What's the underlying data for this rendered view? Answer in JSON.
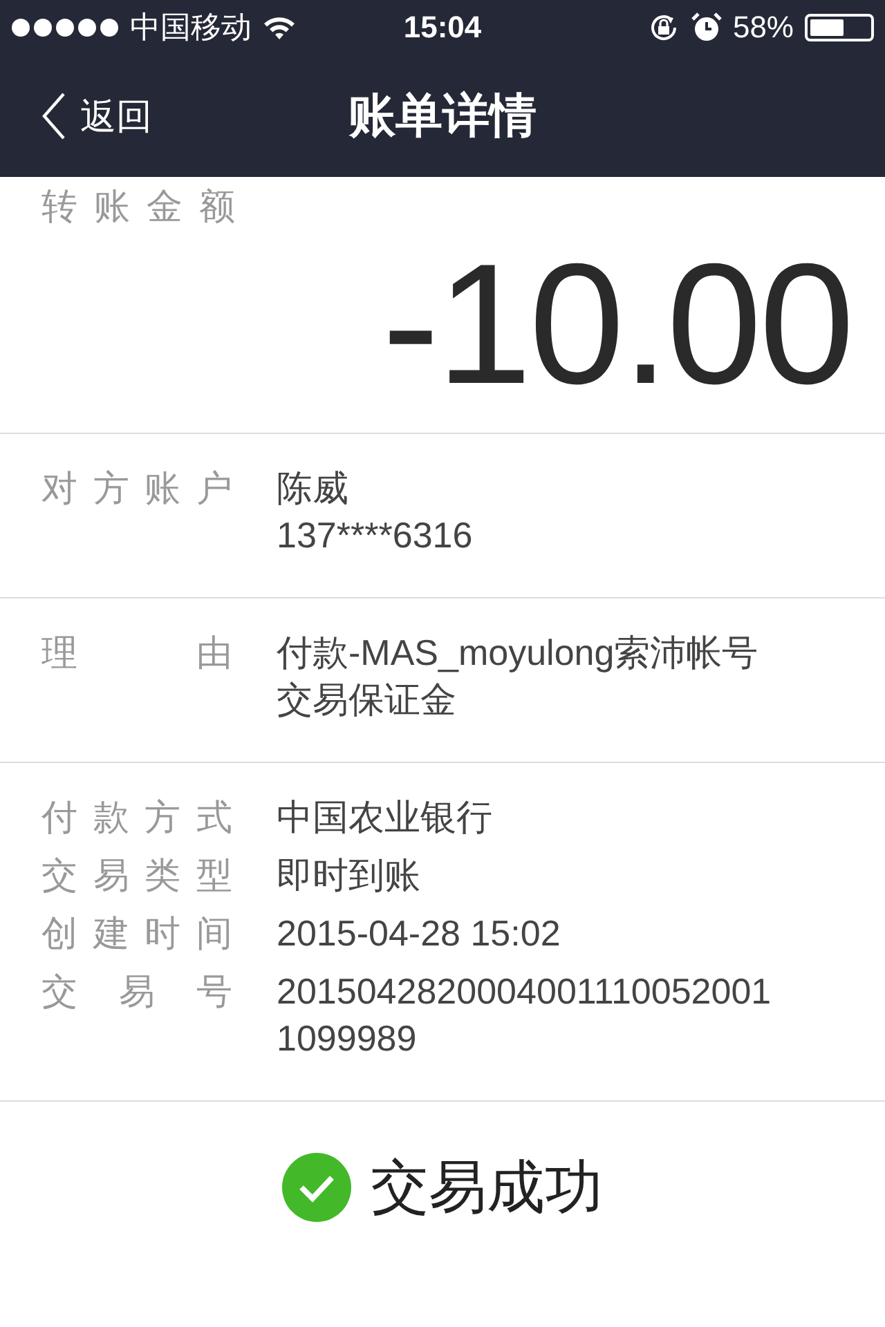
{
  "status_bar": {
    "carrier": "中国移动",
    "time": "15:04",
    "battery": "58%"
  },
  "nav": {
    "back": "返回",
    "title": "账单详情"
  },
  "amount": {
    "label": "转账金额",
    "value": "-10.00"
  },
  "groups": [
    {
      "rows": [
        {
          "label": "对方账户",
          "lines": [
            "陈威",
            "137****6316"
          ]
        }
      ]
    },
    {
      "rows": [
        {
          "label": "理由",
          "lines": [
            "付款-MAS_moyulong索沛帐号交易保证金"
          ]
        }
      ]
    },
    {
      "rows": [
        {
          "label": "付款方式",
          "lines": [
            "中国农业银行"
          ]
        },
        {
          "label": "交易类型",
          "lines": [
            "即时到账"
          ]
        },
        {
          "label": "创建时间",
          "lines": [
            "2015-04-28 15:02"
          ]
        },
        {
          "label": "交易号",
          "lines": [
            "20150428200040011100520011099989"
          ]
        }
      ]
    }
  ],
  "result": {
    "text": "交易成功"
  }
}
